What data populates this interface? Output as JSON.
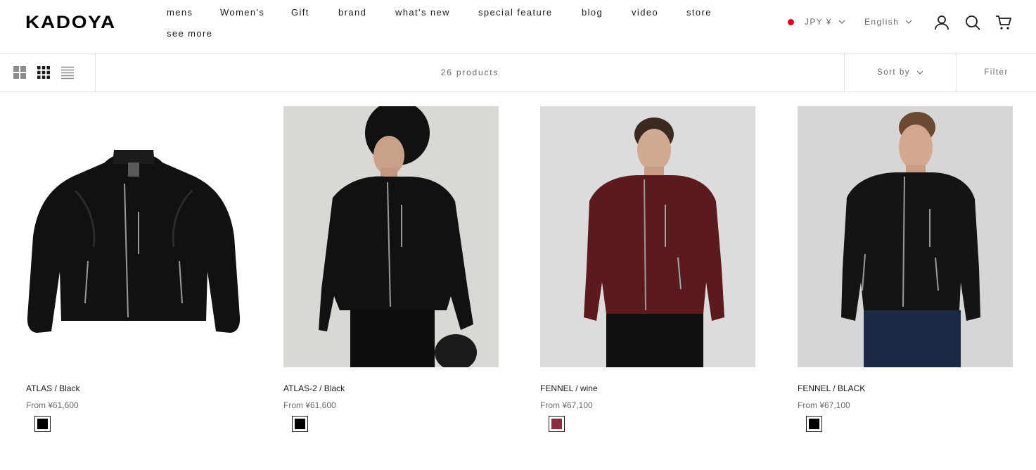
{
  "brand": {
    "logo": "KADOYA"
  },
  "nav": {
    "row1": [
      "mens",
      "Women's",
      "Gift",
      "brand",
      "what's new",
      "special feature",
      "blog",
      "video",
      "store"
    ],
    "row2": [
      "see more"
    ]
  },
  "header": {
    "currency": "JPY ¥",
    "language": "English",
    "flag_color": "#e3001b"
  },
  "toolbar": {
    "count": "26 products",
    "sort_label": "Sort by",
    "filter_label": "Filter"
  },
  "products": [
    {
      "name": "ATLAS / Black",
      "price": "From ¥61,600",
      "swatch": "#000000",
      "jacket_color": "#111111"
    },
    {
      "name": "ATLAS-2 / Black",
      "price": "From ¥61,600",
      "swatch": "#000000",
      "jacket_color": "#121212"
    },
    {
      "name": "FENNEL / wine",
      "price": "From ¥67,100",
      "swatch": "#8c2e3e",
      "jacket_color": "#5c1a1e"
    },
    {
      "name": "FENNEL / BLACK",
      "price": "From ¥67,100",
      "swatch": "#000000",
      "jacket_color": "#141414"
    }
  ]
}
